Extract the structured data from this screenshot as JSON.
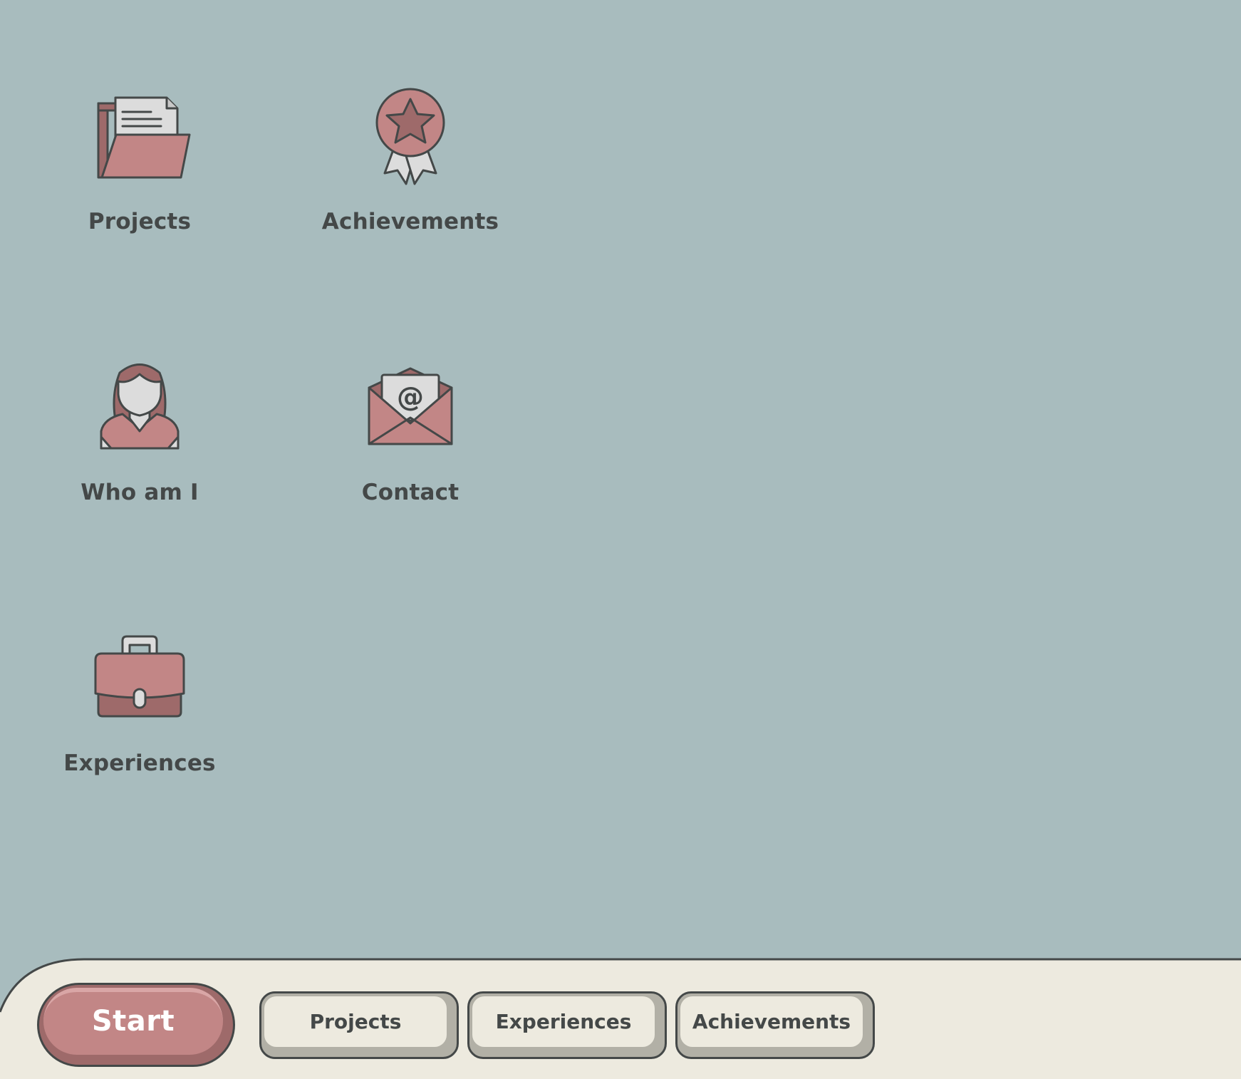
{
  "desktop": {
    "icons": [
      {
        "label": "Projects",
        "icon": "folder-icon"
      },
      {
        "label": "Achievements",
        "icon": "award-ribbon-icon"
      },
      {
        "label": "Who am I",
        "icon": "woman-avatar-icon"
      },
      {
        "label": "Contact",
        "icon": "email-envelope-icon"
      },
      {
        "label": "Experiences",
        "icon": "briefcase-icon"
      }
    ]
  },
  "taskbar": {
    "start_label": "Start",
    "tasks": [
      {
        "label": "Projects"
      },
      {
        "label": "Experiences"
      },
      {
        "label": "Achievements"
      }
    ]
  },
  "colors": {
    "desktop_background": "#a8bcbe",
    "taskbar_background": "#edeadf",
    "accent": "#c28686",
    "accent_dark": "#9e6a6a",
    "outline": "#444848"
  }
}
